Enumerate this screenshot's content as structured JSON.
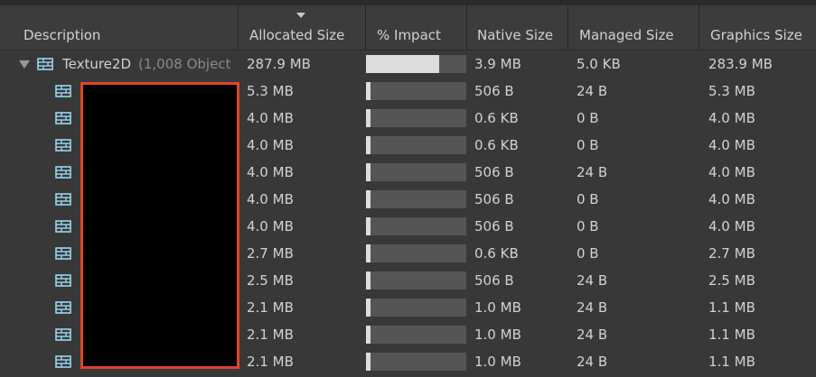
{
  "columns": {
    "description": "Description",
    "allocated": "Allocated Size",
    "impact": "% Impact",
    "native": "Native Size",
    "managed": "Managed Size",
    "graphics": "Graphics Size"
  },
  "sort_icon": "sort-descending-icon",
  "group": {
    "icon": "texture-icon",
    "name": "Texture2D",
    "count": "(1,008 Object",
    "allocated": "287.9 MB",
    "impact": 0.73,
    "native": "3.9 MB",
    "managed": "5.0 KB",
    "graphics": "283.9 MB"
  },
  "rows": [
    {
      "allocated": "5.3 MB",
      "impact": 0.045,
      "native": "506 B",
      "managed": "24 B",
      "graphics": "5.3 MB"
    },
    {
      "allocated": "4.0 MB",
      "impact": 0.045,
      "native": "0.6 KB",
      "managed": "0 B",
      "graphics": "4.0 MB"
    },
    {
      "allocated": "4.0 MB",
      "impact": 0.045,
      "native": "0.6 KB",
      "managed": "0 B",
      "graphics": "4.0 MB"
    },
    {
      "allocated": "4.0 MB",
      "impact": 0.045,
      "native": "506 B",
      "managed": "24 B",
      "graphics": "4.0 MB"
    },
    {
      "allocated": "4.0 MB",
      "impact": 0.045,
      "native": "506 B",
      "managed": "0 B",
      "graphics": "4.0 MB"
    },
    {
      "allocated": "4.0 MB",
      "impact": 0.045,
      "native": "506 B",
      "managed": "0 B",
      "graphics": "4.0 MB"
    },
    {
      "allocated": "2.7 MB",
      "impact": 0.045,
      "native": "0.6 KB",
      "managed": "0 B",
      "graphics": "2.7 MB"
    },
    {
      "allocated": "2.5 MB",
      "impact": 0.045,
      "native": "506 B",
      "managed": "24 B",
      "graphics": "2.5 MB"
    },
    {
      "allocated": "2.1 MB",
      "impact": 0.045,
      "native": "1.0 MB",
      "managed": "24 B",
      "graphics": "1.1 MB"
    },
    {
      "allocated": "2.1 MB",
      "impact": 0.045,
      "native": "1.0 MB",
      "managed": "24 B",
      "graphics": "1.1 MB"
    },
    {
      "allocated": "2.1 MB",
      "impact": 0.045,
      "native": "1.0 MB",
      "managed": "24 B",
      "graphics": "1.1 MB"
    }
  ],
  "colors": {
    "background": "#383838",
    "header": "#3c3c3c",
    "text": "#d2d2d2",
    "bar_track": "#555555",
    "bar_fill": "#dcdcdc",
    "icon": "#9ad8f2",
    "redaction_border": "#e0442b"
  }
}
